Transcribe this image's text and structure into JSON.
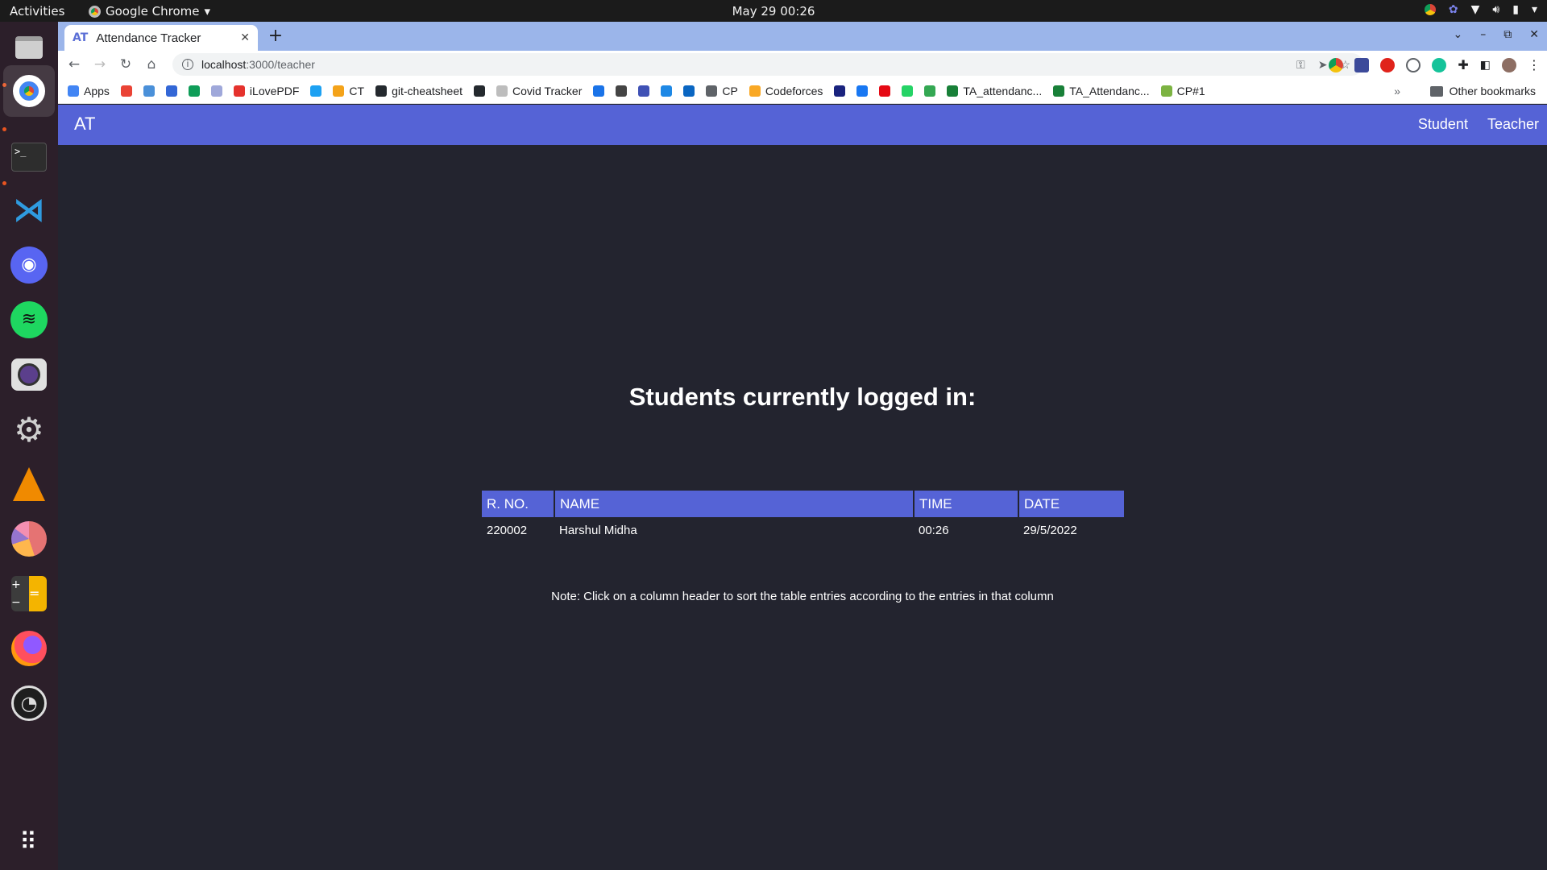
{
  "system": {
    "activities": "Activities",
    "app_name": "Google Chrome",
    "clock": "May 29  00:26"
  },
  "browser": {
    "tab_title": "Attendance Tracker",
    "tab_favicon": "AT",
    "url_host": "localhost",
    "url_path": ":3000/teacher",
    "bookmarks": [
      {
        "label": "Apps",
        "icon": "apps-grid-icon",
        "color": "#4285f4"
      },
      {
        "label": "",
        "icon": "gmail-icon",
        "color": "#ea4335"
      },
      {
        "label": "",
        "icon": "bookmark-icon-2",
        "color": "#4a90d9"
      },
      {
        "label": "",
        "icon": "bookmark-icon-3",
        "color": "#3367d6"
      },
      {
        "label": "",
        "icon": "drive-icon",
        "color": "#0f9d58"
      },
      {
        "label": "",
        "icon": "bookmark-icon-5",
        "color": "#9fa8da"
      },
      {
        "label": "iLovePDF",
        "icon": "ilovepdf-icon",
        "color": "#e5322d"
      },
      {
        "label": "",
        "icon": "twitter-icon",
        "color": "#1da1f2"
      },
      {
        "label": "CT",
        "icon": "ct-icon",
        "color": "#f4a31a"
      },
      {
        "label": "git-cheatsheet",
        "icon": "github-icon",
        "color": "#24292e"
      },
      {
        "label": "",
        "icon": "github-icon-2",
        "color": "#24292e"
      },
      {
        "label": "Covid Tracker",
        "icon": "covid-tracker-icon",
        "color": "#bdbdbd"
      },
      {
        "label": "",
        "icon": "play-icon",
        "color": "#1a73e8"
      },
      {
        "label": "",
        "icon": "bookmark-icon-13",
        "color": "#444444"
      },
      {
        "label": "",
        "icon": "bookmark-icon-14",
        "color": "#3f51b5"
      },
      {
        "label": "",
        "icon": "chart-bars-icon",
        "color": "#1e88e5"
      },
      {
        "label": "",
        "icon": "linkedin-icon",
        "color": "#0a66c2"
      },
      {
        "label": "CP",
        "icon": "folder-icon",
        "color": "#5f6368"
      },
      {
        "label": "Codeforces",
        "icon": "codeforces-icon",
        "color": "#f9a825"
      },
      {
        "label": "",
        "icon": "bookmark-icon-20",
        "color": "#1a237e"
      },
      {
        "label": "",
        "icon": "facebook-icon",
        "color": "#1877f2"
      },
      {
        "label": "",
        "icon": "netflix-icon",
        "color": "#e50914"
      },
      {
        "label": "",
        "icon": "whatsapp-icon",
        "color": "#25d366"
      },
      {
        "label": "",
        "icon": "bookmark-icon-24",
        "color": "#34a853"
      },
      {
        "label": "TA_attendanc...",
        "icon": "sheets-icon",
        "color": "#188038"
      },
      {
        "label": "TA_Attendanc...",
        "icon": "sheets-icon-2",
        "color": "#188038"
      },
      {
        "label": "CP#1",
        "icon": "cp1-icon",
        "color": "#7cb342"
      }
    ],
    "bookmarks_more": "»",
    "other_bookmarks": "Other bookmarks"
  },
  "app": {
    "brand": "AT",
    "nav": {
      "student": "Student",
      "teacher": "Teacher"
    },
    "heading": "Students currently logged in:",
    "table": {
      "headers": [
        "R. NO.",
        "NAME",
        "TIME",
        "DATE"
      ],
      "rows": [
        [
          "220002",
          "Harshul Midha",
          "00:26",
          "29/5/2022"
        ]
      ]
    },
    "note": "Note: Click on a column header to sort the table entries according to the entries in that column"
  },
  "colors": {
    "navbar": "#5563d6",
    "page_bg": "#23242f",
    "header_bg": "#5563d6"
  }
}
